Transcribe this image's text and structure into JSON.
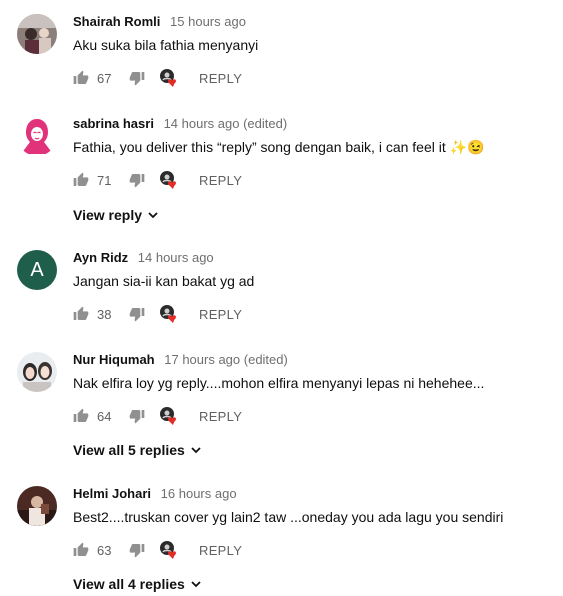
{
  "comments": [
    {
      "author": "Shairah Romli",
      "time": "15 hours ago",
      "text": "Aku suka bila fathia menyanyi",
      "likes": "67",
      "reply_label": "REPLY"
    },
    {
      "author": "sabrina hasri",
      "time": "14 hours ago (edited)",
      "text": "Fathia, you deliver this “reply” song dengan baik, i can feel it ✨😉",
      "likes": "71",
      "reply_label": "REPLY",
      "expand_label": "View reply"
    },
    {
      "author": "Ayn Ridz",
      "time": "14 hours ago",
      "text": "Jangan sia-ii kan bakat yg ad",
      "likes": "38",
      "reply_label": "REPLY",
      "avatar_letter": "A",
      "avatar_color": "#1f5e4a"
    },
    {
      "author": "Nur Hiqumah",
      "time": "17 hours ago (edited)",
      "text": "Nak elfira loy yg reply....mohon elfira menyanyi lepas ni hehehee...",
      "likes": "64",
      "reply_label": "REPLY",
      "expand_label": "View all 5 replies"
    },
    {
      "author": "Helmi Johari",
      "time": "16 hours ago",
      "text": "Best2....truskan cover yg lain2 taw ...oneday you ada lagu you sendiri",
      "likes": "63",
      "reply_label": "REPLY",
      "expand_label": "View all 4 replies"
    }
  ],
  "colors": {
    "heart": "#e52d27",
    "meta_gray": "#6f6f6f",
    "icon_gray": "#909090",
    "sabrina_avatar": "#e0337a"
  }
}
